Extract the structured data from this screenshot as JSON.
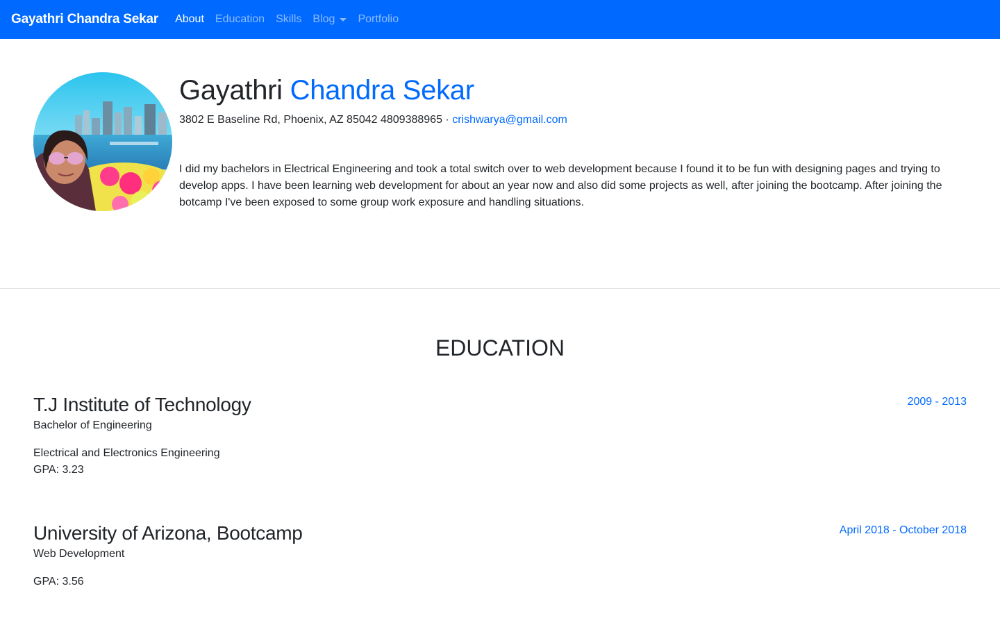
{
  "nav": {
    "brand": "Gayathri Chandra Sekar",
    "items": [
      {
        "label": "About"
      },
      {
        "label": "Education"
      },
      {
        "label": "Skills"
      },
      {
        "label": "Blog"
      },
      {
        "label": "Portfolio"
      }
    ]
  },
  "about": {
    "first_name": "Gayathri",
    "last_name": "Chandra Sekar",
    "address": "3802 E Baseline Rd, Phoenix, AZ 85042 4809388965 ·",
    "email": "crishwarya@gmail.com",
    "bio": "I did my bachelors in Electrical Engineering and took a total switch over to web development because I found it to be fun with designing pages and trying to develop apps. I have been learning web development for about an year now and also did some projects as well, after joining the bootcamp. After joining the botcamp I've been exposed to some group work exposure and handling situations."
  },
  "education": {
    "title": "EDUCATION",
    "entries": [
      {
        "school": "T.J Institute of Technology",
        "degree": "Bachelor of Engineering",
        "field": "Electrical and Electronics Engineering",
        "gpa": "GPA: 3.23",
        "dates": "2009 - 2013"
      },
      {
        "school": "University of Arizona, Bootcamp",
        "degree": "Web Development",
        "field": "",
        "gpa": "GPA: 3.56",
        "dates": "April 2018 - October 2018"
      }
    ]
  },
  "colors": {
    "primary": "#0069ff",
    "text": "#212529"
  }
}
